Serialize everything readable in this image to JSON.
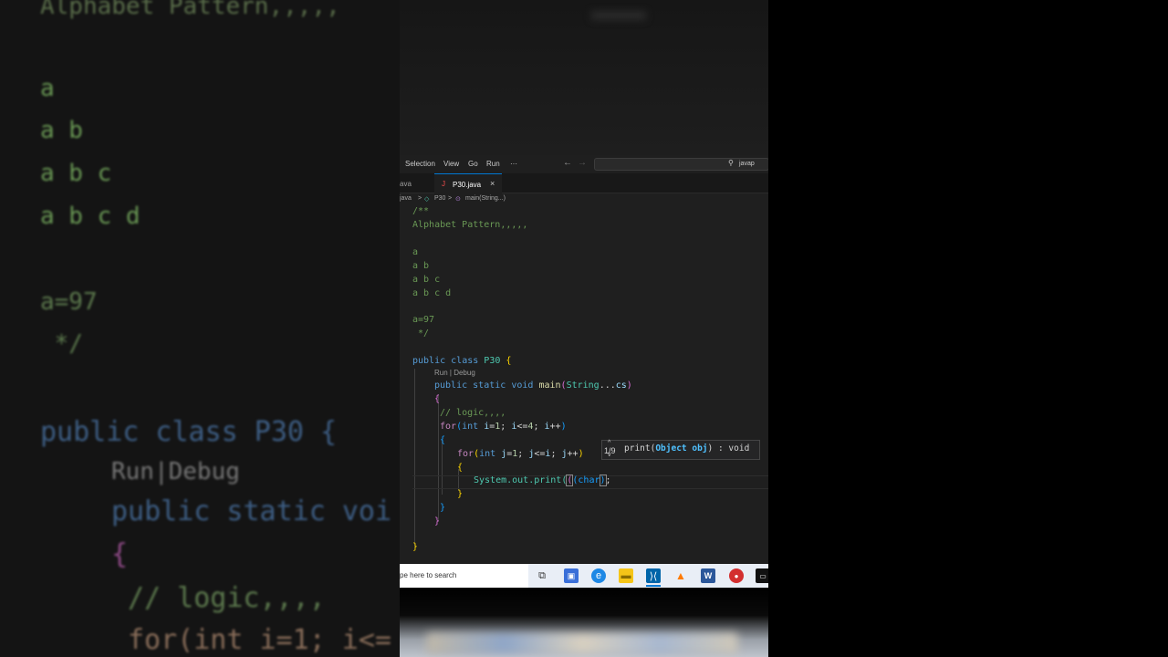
{
  "background": {
    "lines": [
      "Alphabet Pattern,,,,,",
      "a",
      "a b",
      "a b c",
      "a b c d",
      "a=97",
      " */",
      "public class P30 {",
      "Run|Debug",
      "public static voi",
      "{",
      "// logic,,,,",
      "for(int i=1; i<="
    ]
  },
  "menubar": {
    "items": [
      "Selection",
      "View",
      "Go",
      "Run",
      "···"
    ],
    "back_arrow": "←",
    "forward_arrow": "→",
    "search_text": "javap"
  },
  "tabs": {
    "prev_label": "ava",
    "active_label": "P30.java",
    "active_icon": "J",
    "close": "×"
  },
  "breadcrumb": {
    "first": "java",
    "sep": ">",
    "second": "P30",
    "third": "main(String...)"
  },
  "code": {
    "l1": "/**",
    "l2": "Alphabet Pattern,,,,,",
    "l3": "a",
    "l4": "a b",
    "l5": "a b c",
    "l6": "a b c d",
    "l7": "a=97",
    "l8": " */",
    "lens": "Run | Debug",
    "comment_logic": "// logic,,,,",
    "sysout": "System.out.print(",
    "cast": "(char",
    "close_call": ");"
  },
  "hint": {
    "count": "1/9",
    "up": "^",
    "down": "v",
    "name": "print(",
    "param": "Object obj",
    "rest": ") : void"
  },
  "taskbar": {
    "search_placeholder": "pe here to search",
    "icons": [
      "task-view",
      "store",
      "edge",
      "file-explorer",
      "vscode",
      "vlc",
      "word",
      "app-red",
      "terminal"
    ]
  },
  "colors": {
    "editor_bg": "#1f1f1f",
    "accent": "#0078d4",
    "comment": "#6a9955",
    "keyword": "#569cd6"
  }
}
